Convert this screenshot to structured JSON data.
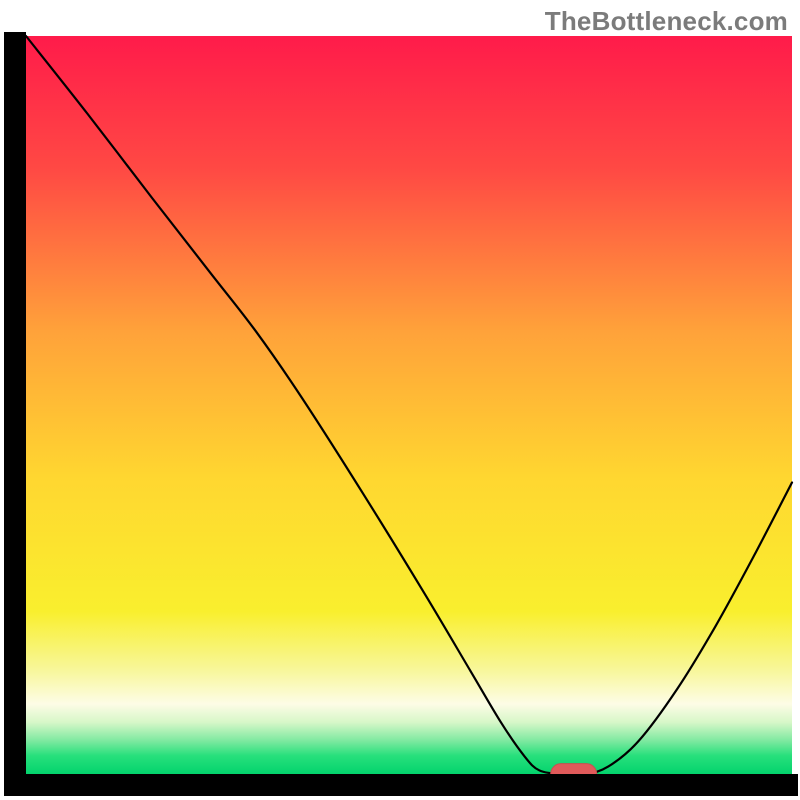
{
  "watermark": {
    "text": "TheBottleneck.com"
  },
  "colors": {
    "curve_stroke": "#000000",
    "axis_stroke": "#000000",
    "marker_fill": "#e05a5a",
    "marker_stroke": "#c94f4f",
    "gradient_stops": [
      {
        "offset": 0.0,
        "color": "#ff1b4a"
      },
      {
        "offset": 0.18,
        "color": "#ff4944"
      },
      {
        "offset": 0.4,
        "color": "#ffa23a"
      },
      {
        "offset": 0.6,
        "color": "#ffd730"
      },
      {
        "offset": 0.78,
        "color": "#f9ef2e"
      },
      {
        "offset": 0.86,
        "color": "#f8f79c"
      },
      {
        "offset": 0.905,
        "color": "#fdfce6"
      },
      {
        "offset": 0.93,
        "color": "#d7f7c8"
      },
      {
        "offset": 0.955,
        "color": "#7ee9a0"
      },
      {
        "offset": 0.975,
        "color": "#28e07c"
      },
      {
        "offset": 1.0,
        "color": "#03d36d"
      }
    ]
  },
  "chart_data": {
    "type": "line",
    "title": "",
    "xlabel": "",
    "ylabel": "",
    "xlim": [
      0,
      100
    ],
    "ylim": [
      0,
      100
    ],
    "grid": false,
    "legend": false,
    "series": [
      {
        "name": "bottleneck-curve",
        "points": [
          {
            "x": 0.0,
            "y": 100.0
          },
          {
            "x": 8.0,
            "y": 89.5
          },
          {
            "x": 16.5,
            "y": 78.0
          },
          {
            "x": 24.0,
            "y": 68.0
          },
          {
            "x": 30.0,
            "y": 60.0
          },
          {
            "x": 36.0,
            "y": 51.0
          },
          {
            "x": 44.0,
            "y": 38.0
          },
          {
            "x": 52.0,
            "y": 24.5
          },
          {
            "x": 58.0,
            "y": 14.0
          },
          {
            "x": 62.0,
            "y": 7.0
          },
          {
            "x": 65.0,
            "y": 2.5
          },
          {
            "x": 67.0,
            "y": 0.5
          },
          {
            "x": 70.0,
            "y": 0.0
          },
          {
            "x": 73.0,
            "y": 0.0
          },
          {
            "x": 76.0,
            "y": 1.0
          },
          {
            "x": 80.0,
            "y": 4.5
          },
          {
            "x": 85.0,
            "y": 11.5
          },
          {
            "x": 90.0,
            "y": 20.0
          },
          {
            "x": 95.0,
            "y": 29.5
          },
          {
            "x": 100.0,
            "y": 39.5
          }
        ]
      }
    ],
    "marker": {
      "x": 71.5,
      "y": 0.0,
      "rx": 3.0,
      "ry": 1.4
    }
  }
}
